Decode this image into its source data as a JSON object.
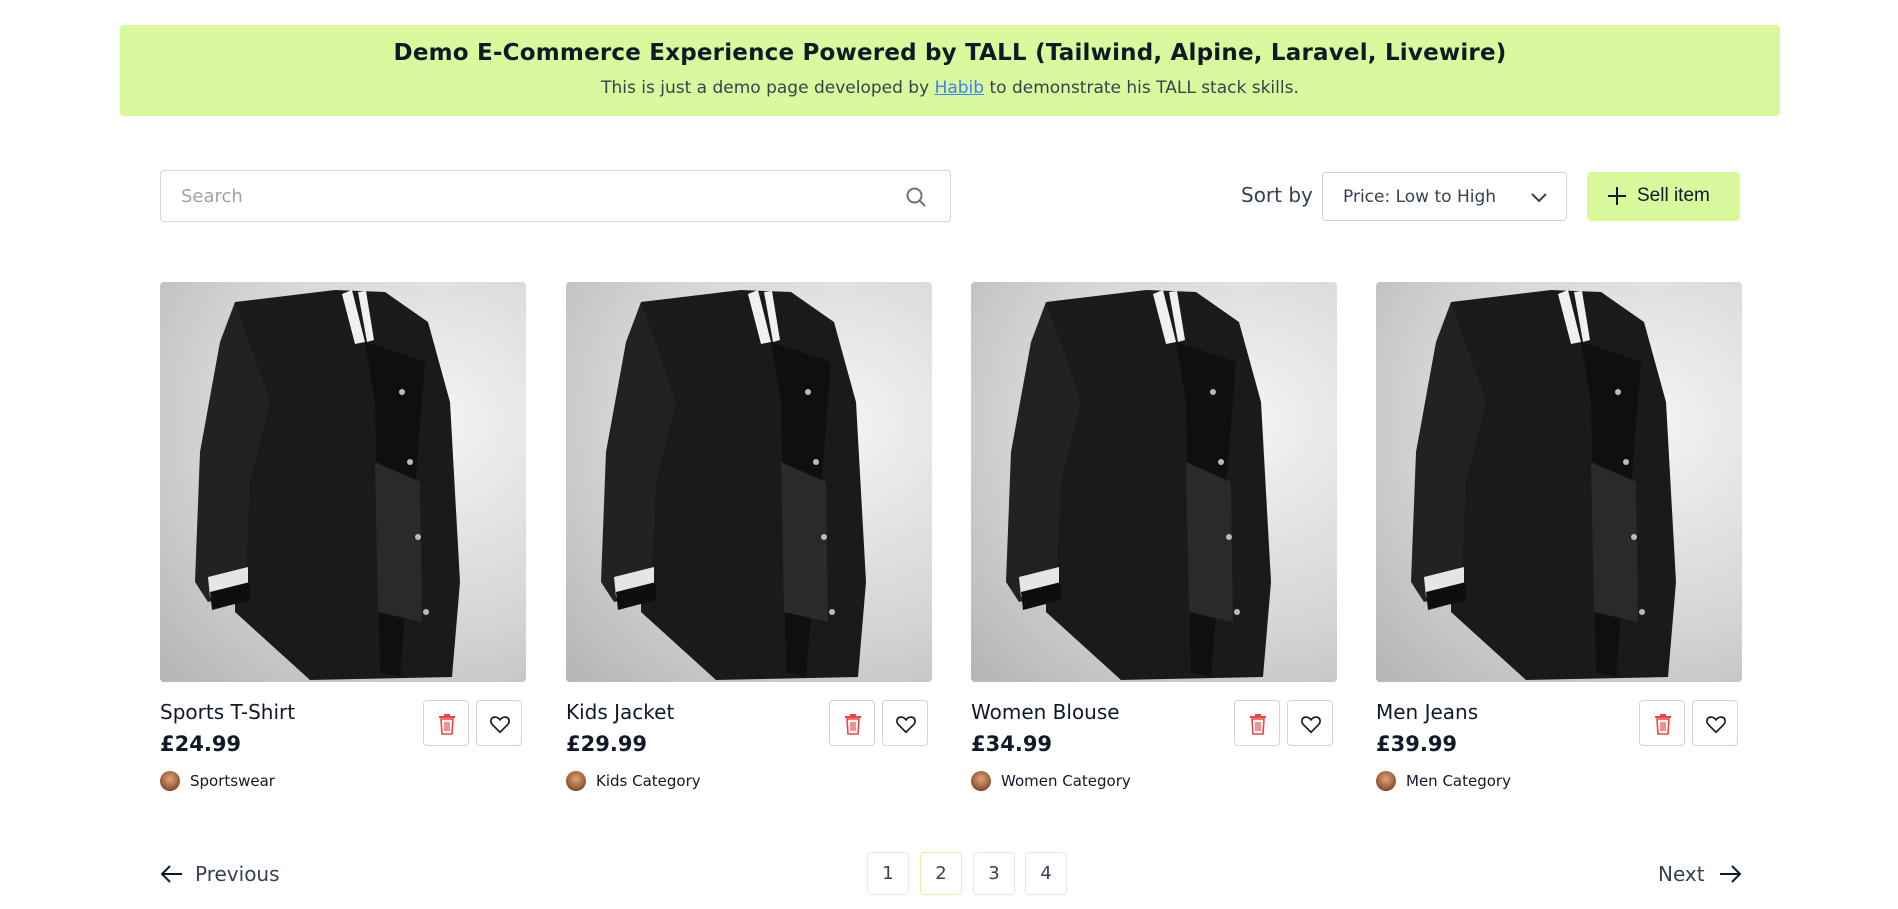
{
  "banner": {
    "title": "Demo E-Commerce Experience Powered by TALL (Tailwind, Alpine, Laravel, Livewire)",
    "subtitle_before": "This is just a demo page developed by ",
    "author_link": "Habib",
    "subtitle_after": " to demonstrate his TALL stack skills."
  },
  "search": {
    "placeholder": "Search",
    "value": "",
    "icon": "search-icon"
  },
  "sort": {
    "label": "Sort by",
    "selected": "Price: Low to High",
    "icon": "chevron-down-icon"
  },
  "sell_button": {
    "label": "Sell item",
    "icon": "plus-icon"
  },
  "products": [
    {
      "name": "Sports T-Shirt",
      "price": "£24.99",
      "category": "Sportswear"
    },
    {
      "name": "Kids Jacket",
      "price": "£29.99",
      "category": "Kids Category"
    },
    {
      "name": "Women Blouse",
      "price": "£34.99",
      "category": "Women Category"
    },
    {
      "name": "Men Jeans",
      "price": "£39.99",
      "category": "Men Category"
    }
  ],
  "pagination": {
    "previous_label": "Previous",
    "next_label": "Next",
    "pages": [
      "1",
      "2",
      "3",
      "4"
    ],
    "current_page": "2"
  },
  "colors": {
    "accent": "#d9f99d",
    "link": "#3b82f6",
    "delete": "#ef4444"
  }
}
